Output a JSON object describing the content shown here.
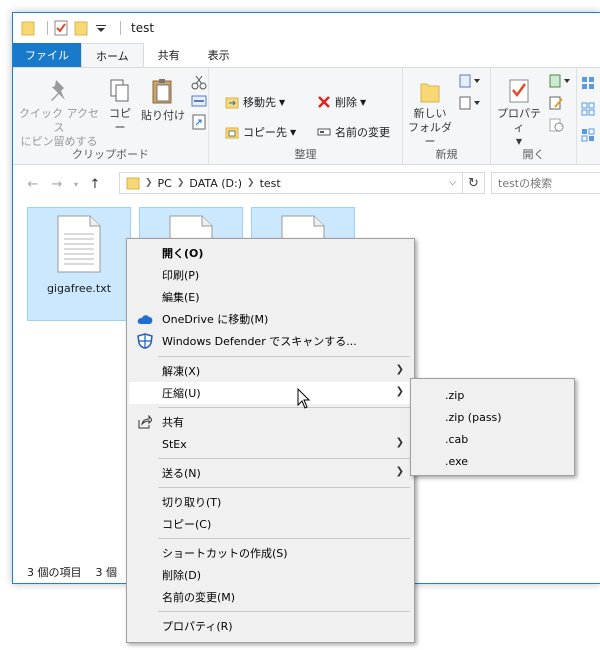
{
  "window": {
    "title": "test",
    "accent": "#1979ca"
  },
  "tabs": [
    {
      "label": "ファイル"
    },
    {
      "label": "ホーム"
    },
    {
      "label": "共有"
    },
    {
      "label": "表示"
    }
  ],
  "ribbon": {
    "clipboard": {
      "pin_label_1": "クイック アクセス",
      "pin_label_2": "にピン留めする",
      "copy_label": "コピー",
      "paste_label": "貼り付け",
      "group_label": "クリップボード"
    },
    "organize": {
      "move_label": "移動先",
      "copy_to_label": "コピー先",
      "delete_label": "削除",
      "rename_label": "名前の変更",
      "group_label": "整理"
    },
    "new": {
      "new_folder_label_1": "新しい",
      "new_folder_label_2": "フォルダー",
      "group_label": "新規"
    },
    "open": {
      "properties_label": "プロパティ",
      "group_label": "開く"
    }
  },
  "address": {
    "crumbs": [
      "PC",
      "DATA (D:)",
      "test"
    ],
    "search_placeholder": "testの検索"
  },
  "files": [
    {
      "name": "gigafree.txt"
    },
    {
      "name": ""
    },
    {
      "name": ""
    }
  ],
  "status": {
    "item_count": "3 個の項目",
    "selected_count": "3 個"
  },
  "context_menu": {
    "items": [
      {
        "label": "開く(O)"
      },
      {
        "label": "印刷(P)"
      },
      {
        "label": "編集(E)"
      },
      {
        "label": "OneDrive に移動(M)"
      },
      {
        "label": "Windows Defender でスキャンする..."
      },
      {
        "label": "解凍(X)"
      },
      {
        "label": "圧縮(U)"
      },
      {
        "label": "共有"
      },
      {
        "label": "StEx"
      },
      {
        "label": "送る(N)"
      },
      {
        "label": "切り取り(T)"
      },
      {
        "label": "コピー(C)"
      },
      {
        "label": "ショートカットの作成(S)"
      },
      {
        "label": "削除(D)"
      },
      {
        "label": "名前の変更(M)"
      },
      {
        "label": "プロパティ(R)"
      }
    ]
  },
  "submenu": {
    "items": [
      {
        "label": ".zip"
      },
      {
        "label": ".zip (pass)"
      },
      {
        "label": ".cab"
      },
      {
        "label": ".exe"
      }
    ]
  }
}
